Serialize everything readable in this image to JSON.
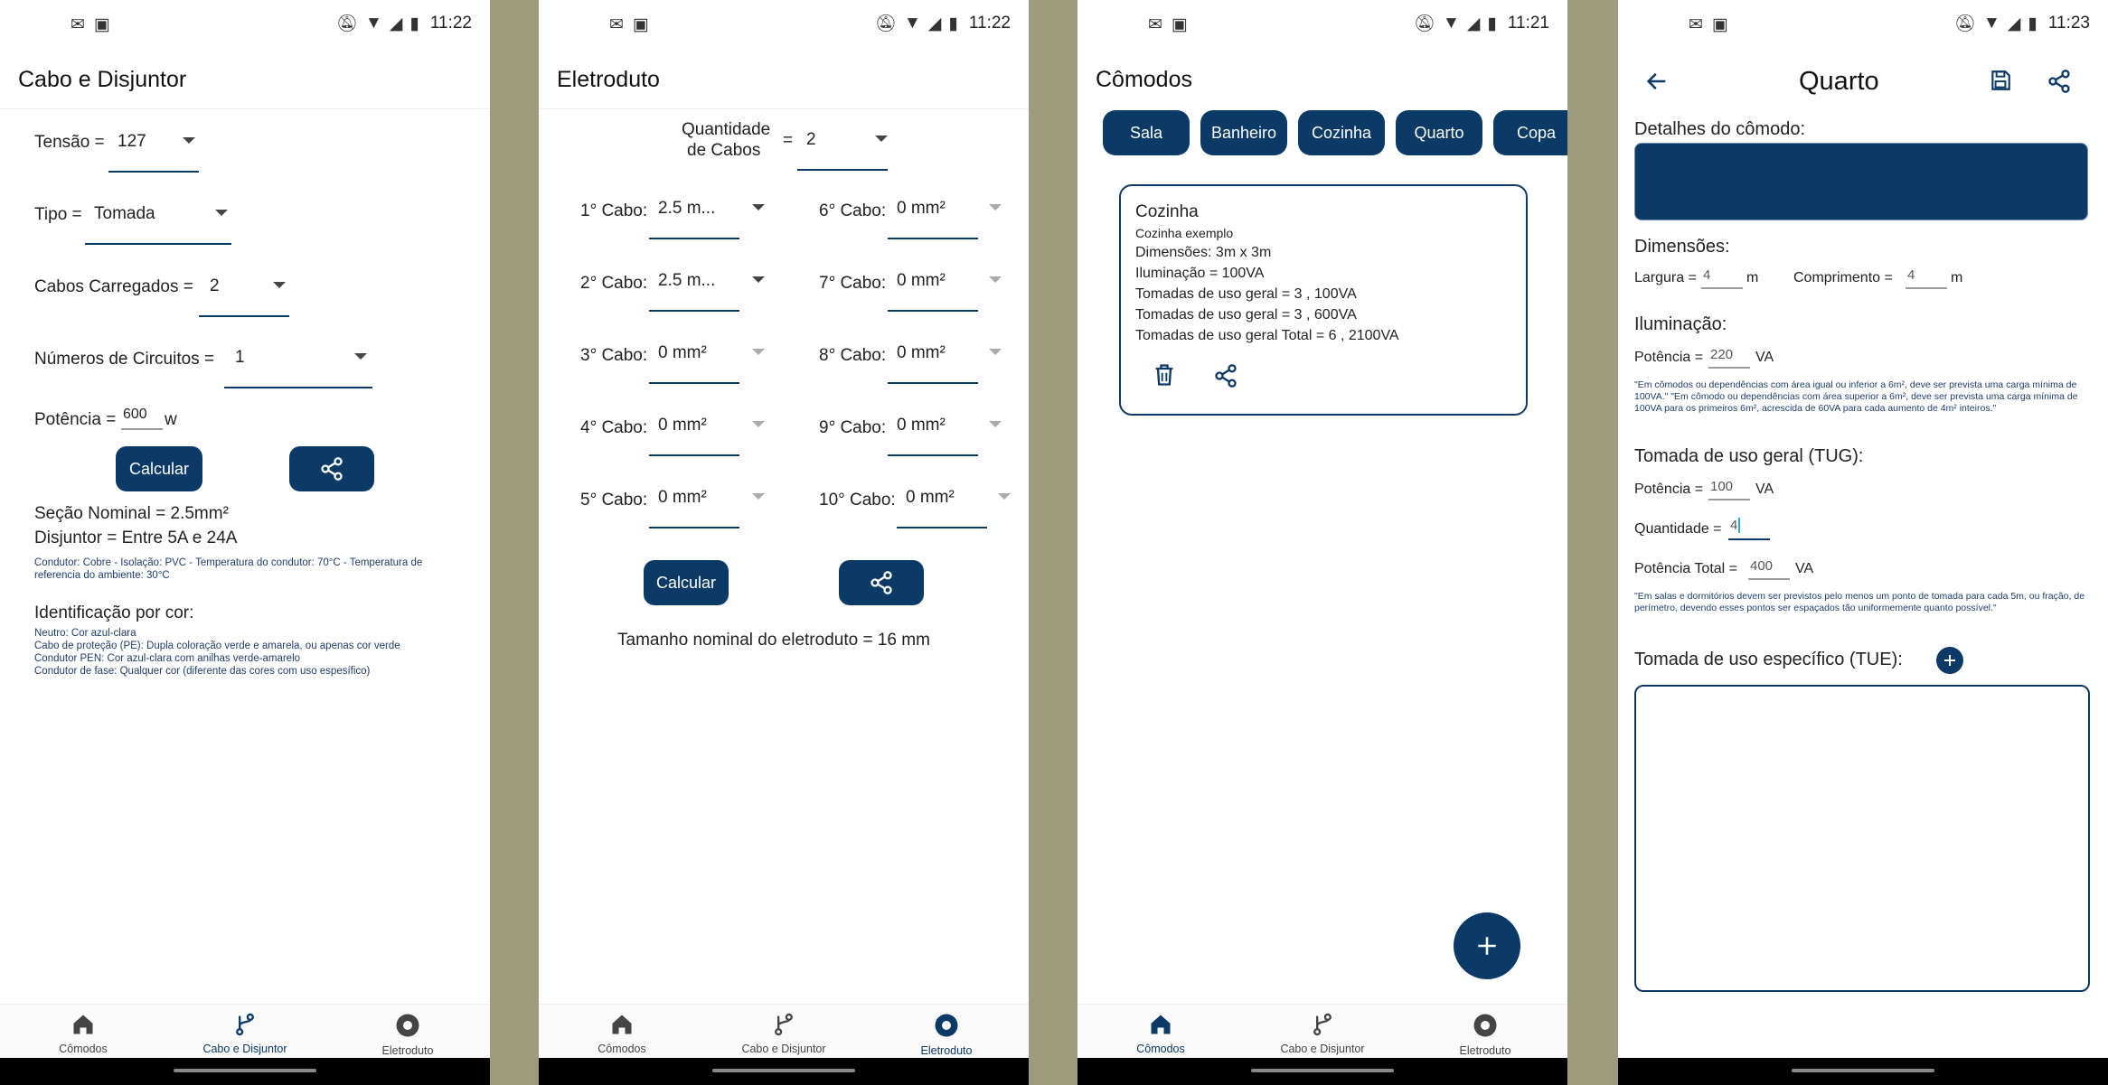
{
  "status": {
    "time1": "11:22",
    "time2": "11:22",
    "time3": "11:21",
    "time4": "11:23"
  },
  "nav": {
    "comodos": "Cômodos",
    "cabo": "Cabo e Disjuntor",
    "eletroduto": "Eletroduto"
  },
  "screen1": {
    "title": "Cabo e Disjuntor",
    "tensao_label": "Tensão =",
    "tensao_value": "127",
    "tipo_label": "Tipo =",
    "tipo_value": "Tomada",
    "cabos_label": "Cabos Carregados =",
    "cabos_value": "2",
    "circuitos_label": "Números de Circuitos =",
    "circuitos_value": "1",
    "potencia_label": "Potência =",
    "potencia_value": "600",
    "potencia_unit": "w",
    "calcular": "Calcular",
    "secao": "Seção Nominal =  2.5mm²",
    "disjuntor": "Disjuntor = Entre 5A e 24A",
    "condutor_info": "Condutor: Cobre - Isolação: PVC - Temperatura do condutor: 70°C - Temperatura de referencia do ambiente: 30°C",
    "ident_title": "Identificação por cor:",
    "ident_lines": [
      "Neutro: Cor azul-clara",
      "Cabo de proteção (PE): Dupla coloração verde e amarela, ou apenas cor verde",
      "Condutor PEN: Cor azul-clara com anilhas verde-amarelo",
      "Condutor de fase: Qualquer cor (diferente das cores com uso espesífico)"
    ]
  },
  "screen2": {
    "title": "Eletroduto",
    "qtd_label_1": "Quantidade",
    "qtd_label_2": "de Cabos",
    "qtd_eq": "=",
    "qtd_value": "2",
    "cabos_left": [
      {
        "label": "1° Cabo:",
        "value": "2.5 m..."
      },
      {
        "label": "2° Cabo:",
        "value": "2.5 m..."
      },
      {
        "label": "3° Cabo:",
        "value": "0 mm²"
      },
      {
        "label": "4° Cabo:",
        "value": "0 mm²"
      },
      {
        "label": "5° Cabo:",
        "value": "0 mm²"
      }
    ],
    "cabos_right": [
      {
        "label": "6° Cabo:",
        "value": "0 mm²"
      },
      {
        "label": "7° Cabo:",
        "value": "0 mm²"
      },
      {
        "label": "8° Cabo:",
        "value": "0 mm²"
      },
      {
        "label": "9° Cabo:",
        "value": "0 mm²"
      },
      {
        "label": "10° Cabo:",
        "value": "0 mm²"
      }
    ],
    "calcular": "Calcular",
    "resultado": "Tamanho nominal do eletroduto = 16 mm"
  },
  "screen3": {
    "title": "Cômodos",
    "chips": [
      "Sala",
      "Banheiro",
      "Cozinha",
      "Quarto",
      "Copa"
    ],
    "card": {
      "name": "Cozinha",
      "desc": "Cozinha exemplo",
      "lines": [
        "Dimensões: 3m x 3m",
        "Iluminação = 100VA",
        "Tomadas de uso geral = 3 , 100VA",
        "Tomadas de uso geral = 3 , 600VA",
        "Tomadas de uso geral Total = 6 , 2100VA"
      ]
    }
  },
  "screen4": {
    "title": "Quarto",
    "detalhes": "Detalhes do cômodo:",
    "dimensoes": "Dimensões:",
    "largura_label": "Largura =",
    "largura_value": "4",
    "largura_unit": "m",
    "comprimento_label": "Comprimento =",
    "comprimento_value": "4",
    "comprimento_unit": "m",
    "iluminacao": "Iluminação:",
    "ilum_pot_label": "Potência =",
    "ilum_pot_value": "220",
    "ilum_pot_unit": "VA",
    "ilum_note": "\"Em cômodos ou dependências com área igual ou inferior a 6m², deve ser prevista uma carga mínima de 100VA.\" \"Em cômodo ou dependências com área superior a 6m², deve ser prevista uma carga mínima de 100VA para os primeiros 6m², acrescida de 60VA para cada aumento de 4m² inteiros.\"",
    "tug_title": "Tomada de uso geral (TUG):",
    "tug_pot_label": "Potência =",
    "tug_pot_value": "100",
    "tug_pot_unit": "VA",
    "tug_qtd_label": "Quantidade =",
    "tug_qtd_value": "4",
    "tug_total_label": "Potência Total =",
    "tug_total_value": "400",
    "tug_total_unit": "VA",
    "tug_note": "\"Em salas e dormitórios devem ser previstos pelo menos um ponto de tomada para cada 5m, ou fração, de perímetro, devendo esses pontos ser espaçados tão uniformemente quanto possível.\"",
    "tue_title": "Tomada de uso específico (TUE):"
  }
}
